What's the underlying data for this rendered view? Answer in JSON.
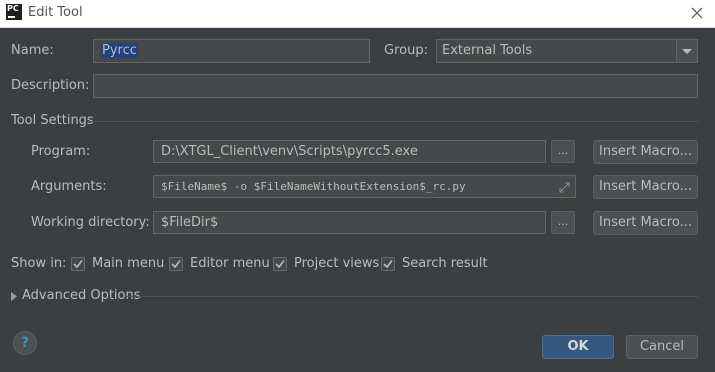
{
  "window": {
    "title": "Edit Tool",
    "app_icon_text": "PC",
    "close_icon": "close-icon"
  },
  "form": {
    "name_label": "Name:",
    "name_value": "Pyrcc",
    "group_label": "Group:",
    "group_value": "External Tools",
    "description_label": "Description:",
    "description_value": ""
  },
  "tool_settings": {
    "title": "Tool Settings",
    "program_label": "Program:",
    "program_value": "D:\\XTGL_Client\\venv\\Scripts\\pyrcc5.exe",
    "arguments_label": "Arguments:",
    "arguments_value": "$FileName$ -o $FileNameWithoutExtension$_rc.py",
    "working_dir_label": "Working directory:",
    "working_dir_value": "$FileDir$",
    "browse_label": "...",
    "insert_macro_label": "Insert Macro..."
  },
  "show_in": {
    "label": "Show in:",
    "options": [
      {
        "label": "Main menu",
        "checked": true
      },
      {
        "label": "Editor menu",
        "checked": true
      },
      {
        "label": "Project views",
        "checked": true
      },
      {
        "label": "Search result",
        "checked": true
      }
    ]
  },
  "advanced": {
    "label": "Advanced Options",
    "expanded": false
  },
  "footer": {
    "help_label": "?",
    "ok_label": "OK",
    "cancel_label": "Cancel"
  },
  "colors": {
    "background": "#3c3f41",
    "selection": "#214283",
    "default_button": "#365880",
    "help_icon": "#3592c4"
  }
}
